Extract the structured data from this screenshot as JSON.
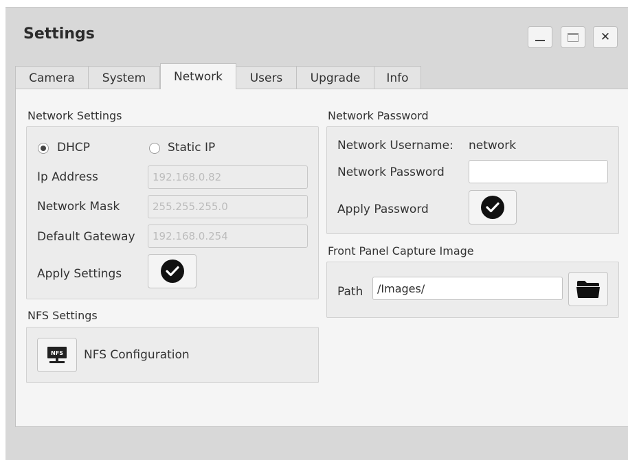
{
  "window": {
    "title": "Settings",
    "close_glyph": "✕"
  },
  "tabs": [
    {
      "label": "Camera"
    },
    {
      "label": "System"
    },
    {
      "label": "Network",
      "active": true
    },
    {
      "label": "Users"
    },
    {
      "label": "Upgrade"
    },
    {
      "label": "Info"
    }
  ],
  "network_settings": {
    "heading": "Network Settings",
    "dhcp_label": "DHCP",
    "static_label": "Static IP",
    "selected_mode": "DHCP",
    "ip_label": "Ip Address",
    "ip_value": "192.168.0.82",
    "mask_label": "Network Mask",
    "mask_value": "255.255.255.0",
    "gateway_label": "Default Gateway",
    "gateway_value": "192.168.0.254",
    "apply_label": "Apply Settings"
  },
  "nfs_settings": {
    "heading": "NFS Settings",
    "config_label": "NFS Configuration",
    "icon_text": "NFS"
  },
  "network_password": {
    "heading": "Network Password",
    "username_label": "Network Username:",
    "username_value": "network",
    "password_label": "Network Password",
    "password_value": "",
    "apply_label": "Apply Password"
  },
  "capture_image": {
    "heading": "Front Panel Capture Image",
    "path_label": "Path",
    "path_value": "/Images/"
  }
}
